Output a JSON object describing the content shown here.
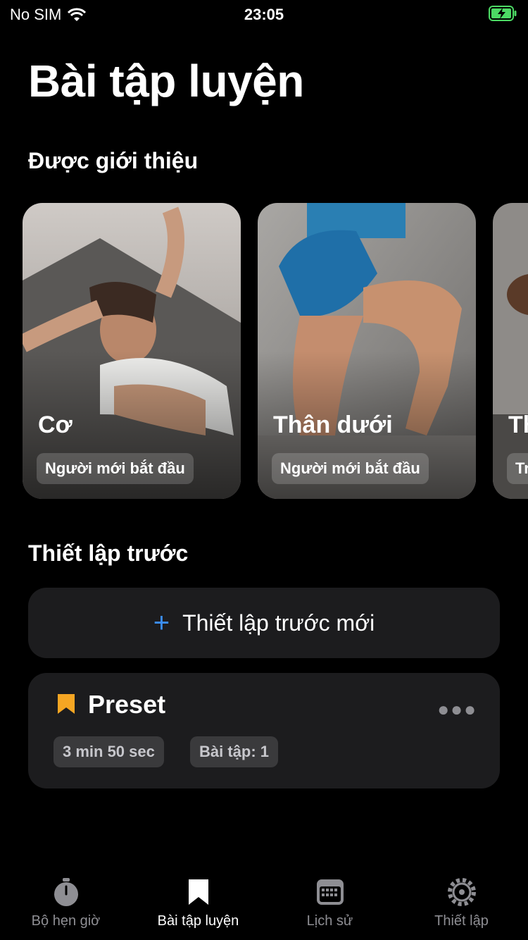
{
  "status": {
    "carrier": "No SIM",
    "time": "23:05"
  },
  "page": {
    "title": "Bài tập luyện"
  },
  "featured": {
    "heading": "Được giới thiệu",
    "cards": [
      {
        "name": "Cơ",
        "level": "Người mới bắt đầu"
      },
      {
        "name": "Thân dưới",
        "level": "Người mới bắt đầu"
      },
      {
        "name": "Th",
        "level": "Tr"
      }
    ]
  },
  "presets": {
    "heading": "Thiết lập trước",
    "new_label": "Thiết lập trước mới",
    "items": [
      {
        "title": "Preset",
        "duration": "3 min 50 sec",
        "exercises": "Bài tập: 1"
      }
    ]
  },
  "tabs": [
    {
      "label": "Bộ hẹn giờ",
      "icon": "stopwatch-icon",
      "active": false
    },
    {
      "label": "Bài tập luyện",
      "icon": "bookmark-icon",
      "active": true
    },
    {
      "label": "Lịch sử",
      "icon": "calendar-icon",
      "active": false
    },
    {
      "label": "Thiết lập",
      "icon": "gear-icon",
      "active": false
    }
  ],
  "colors": {
    "accent": "#3b8df5",
    "bookmark": "#f5a623",
    "card_bg": "#1c1c1e"
  }
}
